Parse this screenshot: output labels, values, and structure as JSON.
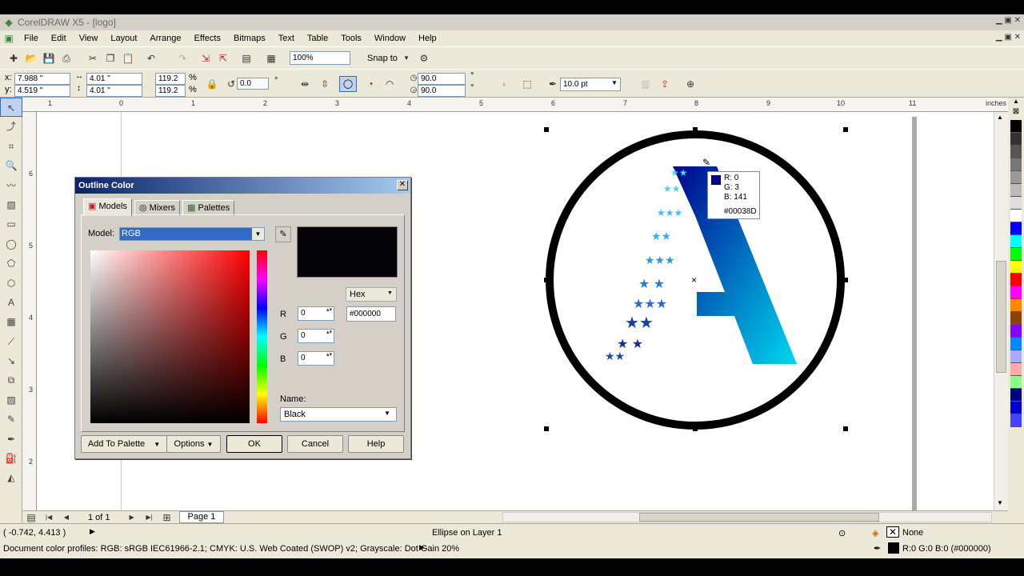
{
  "title_bar": {
    "title": "CorelDRAW X5 - [logo]"
  },
  "menu": [
    "File",
    "Edit",
    "View",
    "Layout",
    "Arrange",
    "Effects",
    "Bitmaps",
    "Text",
    "Table",
    "Tools",
    "Window",
    "Help"
  ],
  "standard_toolbar": {
    "zoom": "100%",
    "snap_to": "Snap to"
  },
  "property_bar": {
    "x": "7.988 \"",
    "y": "4.519 \"",
    "width": "4.01 \"",
    "height": "4.01 \"",
    "scale_x": "119.2",
    "scale_y": "119.2",
    "percent": "%",
    "rotation": "0.0",
    "degree": "°",
    "start_angle": "90.0",
    "end_angle": "90.0",
    "outline_width": "10.0 pt"
  },
  "ruler": {
    "units": "inches",
    "h_ticks": [
      "1",
      "0",
      "1",
      "2",
      "3",
      "4",
      "5",
      "6",
      "7",
      "8",
      "9",
      "10",
      "11"
    ],
    "v_ticks": [
      "6",
      "5",
      "4",
      "3",
      "2"
    ]
  },
  "tooltip": {
    "r": "R: 0",
    "g": "G: 3",
    "b": "B: 141",
    "hex": "#00038D",
    "swatch_color": "#00038D"
  },
  "dialog": {
    "title": "Outline Color",
    "tabs": [
      "Models",
      "Mixers",
      "Palettes"
    ],
    "model_label": "Model:",
    "model_value": "RGB",
    "format": "Hex",
    "hex_value": "#000000",
    "r_label": "R",
    "r_value": "0",
    "g_label": "G",
    "g_value": "0",
    "b_label": "B",
    "b_value": "0",
    "name_label": "Name:",
    "name_value": "Black",
    "buttons": {
      "add_to_palette": "Add To Palette",
      "options": "Options",
      "ok": "OK",
      "cancel": "Cancel",
      "help": "Help"
    }
  },
  "page_nav": {
    "page_count": "1 of 1",
    "page_tab": "Page 1"
  },
  "status": {
    "coords": "( -0.742, 4.413 )",
    "object": "Ellipse on Layer 1",
    "fill": "None",
    "outline": "R:0 G:0 B:0 (#000000)",
    "profiles": "Document color profiles: RGB: sRGB IEC61966-2.1; CMYK: U.S. Web Coated (SWOP) v2; Grayscale: Dot Gain 20%"
  },
  "colors": {
    "accent": "#0a246a",
    "logo_dark": "#00038D",
    "logo_light": "#00d8f0"
  },
  "palette_colors": [
    "#000000",
    "#333333",
    "#555555",
    "#777777",
    "#999999",
    "#bbbbbb",
    "#dddddd",
    "#ffffff",
    "#0000ff",
    "#00ffff",
    "#00ff00",
    "#ffff00",
    "#ff0000",
    "#ff00ff",
    "#ff8800",
    "#884400",
    "#8800ff",
    "#0088ff",
    "#aaaaff",
    "#ffaaaa",
    "#88ff88",
    "#000088",
    "#0000cc",
    "#4444ff"
  ]
}
